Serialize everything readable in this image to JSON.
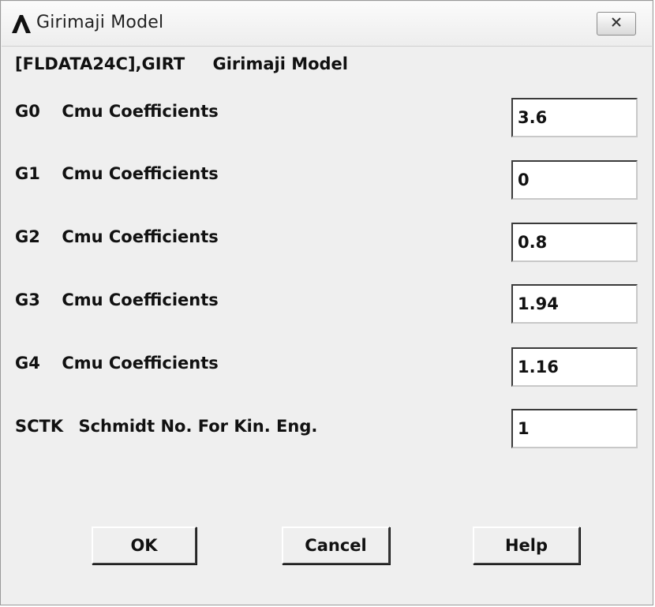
{
  "window": {
    "title": "Girimaji Model",
    "close_label": "✕"
  },
  "header": {
    "command": "[FLDATA24C],GIRT",
    "description": "Girimaji Model"
  },
  "rows": [
    {
      "code": "G0",
      "label": "Cmu Coefficients",
      "value": "3.6"
    },
    {
      "code": "G1",
      "label": "Cmu Coefficients",
      "value": "0"
    },
    {
      "code": "G2",
      "label": "Cmu Coefficients",
      "value": "0.8"
    },
    {
      "code": "G3",
      "label": "Cmu Coefficients",
      "value": "1.94"
    },
    {
      "code": "G4",
      "label": "Cmu Coefficients",
      "value": "1.16"
    },
    {
      "code": "SCTK",
      "label": "Schmidt No. For Kin. Eng.",
      "value": "1"
    }
  ],
  "buttons": {
    "ok": "OK",
    "cancel": "Cancel",
    "help": "Help"
  },
  "icons": {
    "app": "ansys-logo-icon",
    "close": "close-icon"
  }
}
